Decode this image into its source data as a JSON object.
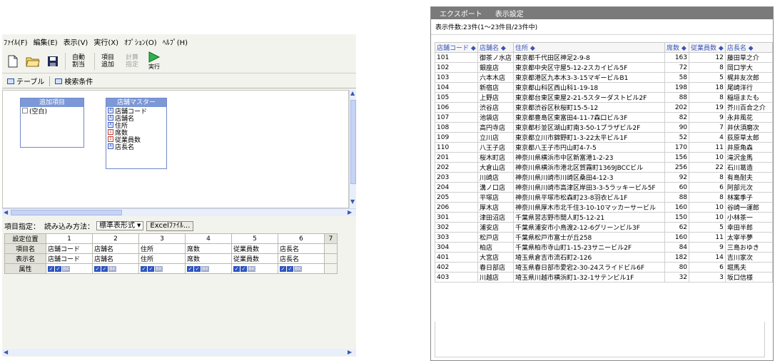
{
  "left_window": {
    "menu": [
      "ﾌｧｲﾙ(F)",
      "編集(E)",
      "表示(V)",
      "実行(X)",
      "ｵﾌﾟｼｮﾝ(O)",
      "ﾍﾙﾌﾟ(H)"
    ],
    "toolbar": {
      "auto_split": "自動割当",
      "add_item": "項目追加",
      "calc_spec": "計算指定",
      "run": "実行"
    },
    "tabs": [
      "テーブル",
      "検索条件"
    ],
    "added_items_box": {
      "title": "追加項目",
      "fields": [
        "(空白)"
      ]
    },
    "store_master_box": {
      "title": "店舗マスター",
      "fields": [
        "店舗コード",
        "店舗名",
        "住所",
        "席数",
        "従業員数",
        "店長名"
      ]
    },
    "settings": {
      "item_spec_label": "項目指定：",
      "read_method_label": "読み込み方法：",
      "read_method_value": "標準表形式",
      "excel_button": "Excelﾌｧｲﾙ...",
      "row_headers": [
        "設定位置",
        "項目名",
        "表示名",
        "属性"
      ],
      "columns": [
        "1",
        "2",
        "3",
        "4",
        "5",
        "6",
        "7"
      ],
      "item_names": [
        "店舗コード",
        "店舗名",
        "住所",
        "席数",
        "従業員数",
        "店長名"
      ],
      "display_names": [
        "店舗コード",
        "店舗名",
        "住所",
        "席数",
        "従業員数",
        "店長名"
      ],
      "attr_flags": [
        "BK",
        "BK",
        "BK",
        "BK",
        "BK",
        "BK"
      ]
    }
  },
  "right_window": {
    "menu": [
      "エクスポート",
      "表示設定"
    ],
    "count_text": "表示件数:23件(1～23件目/23件中)",
    "columns": [
      "店舗コード ◆",
      "店舗名 ◆",
      "住所 ◆",
      "席数 ◆",
      "従業員数 ◆",
      "店長名 ◆"
    ],
    "rows": [
      [
        "101",
        "御茶ノ水店",
        "東京都千代田区神足2-9-8",
        "163",
        "12",
        "藤田草之介"
      ],
      [
        "102",
        "銀座店",
        "東京都中央区守屋5-12-2スカイビル5F",
        "72",
        "8",
        "岡口学大"
      ],
      [
        "103",
        "六本木店",
        "東京都港区九本木3-3-15マギービルB1",
        "58",
        "5",
        "梶井友次郎"
      ],
      [
        "104",
        "新宿店",
        "東京都山科区西山科1-19-18",
        "198",
        "18",
        "尾崎洋行"
      ],
      [
        "105",
        "上野店",
        "東京都台東区東屋2-21-5スターダストビル2F",
        "88",
        "8",
        "稲垣またも"
      ],
      [
        "106",
        "渋谷店",
        "東京都渋谷区秋桜町15-5-12",
        "202",
        "19",
        "芥川百合之介"
      ],
      [
        "107",
        "池袋店",
        "東京都豊島区東富田4-11-7森口ビル3F",
        "82",
        "9",
        "永井風花"
      ],
      [
        "108",
        "高円寺店",
        "東京都杉並区湖山町南3-50-1プラザビル2F",
        "90",
        "7",
        "井伏須磨次"
      ],
      [
        "109",
        "立川店",
        "東京都立川市錦野町1-3-22太平ビル1F",
        "52",
        "4",
        "荻原草太郎"
      ],
      [
        "110",
        "八王子店",
        "東京都八王子市円山町4-7-5",
        "170",
        "11",
        "井原角森"
      ],
      [
        "201",
        "桜木町店",
        "神奈川県横浜市中区新富港1-2-23",
        "156",
        "10",
        "滝沢金馬"
      ],
      [
        "202",
        "大倉山店",
        "神奈川県横浜市港北区賀霧町1369JBCCビル",
        "256",
        "22",
        "石川葛造"
      ],
      [
        "203",
        "川崎店",
        "神奈川県川崎市川崎区桑田4-12-3",
        "92",
        "8",
        "有島耐夫"
      ],
      [
        "204",
        "溝ノ口店",
        "神奈川県川崎市高津区岸田3-3-5ラッキービル5F",
        "60",
        "6",
        "阿部元次"
      ],
      [
        "205",
        "平塚店",
        "神奈川県平塚市松森町23-8羽衣ビル1F",
        "88",
        "8",
        "林案季子"
      ],
      [
        "206",
        "厚木店",
        "神奈川県厚木市北千住3-10-10マッカーサービル",
        "160",
        "10",
        "谷崎一運郎"
      ],
      [
        "301",
        "津田沼店",
        "千葉県習志野市間人町5-12-21",
        "150",
        "10",
        "小林茶一"
      ],
      [
        "302",
        "浦安店",
        "千葉県浦安市小鳥渡2-12-6グリーンビル3F",
        "62",
        "5",
        "幸田半郎"
      ],
      [
        "303",
        "松戸店",
        "千葉県松戸市富士が丘258",
        "160",
        "11",
        "太宰半夢"
      ],
      [
        "304",
        "柏店",
        "千葉県柏市寺山町1-15-23サニービル2F",
        "84",
        "9",
        "三島おゆき"
      ],
      [
        "401",
        "大宮店",
        "埼玉県倉吉市流石町2-126",
        "182",
        "14",
        "吉川家次"
      ],
      [
        "402",
        "春日部店",
        "埼玉県春日部市愛宕2-30-24スライドビル6F",
        "80",
        "6",
        "堀馬夫"
      ],
      [
        "403",
        "川越店",
        "埼玉県川越市横浜町1-32-1サテンビル1F",
        "32",
        "3",
        "坂口信様"
      ]
    ]
  }
}
